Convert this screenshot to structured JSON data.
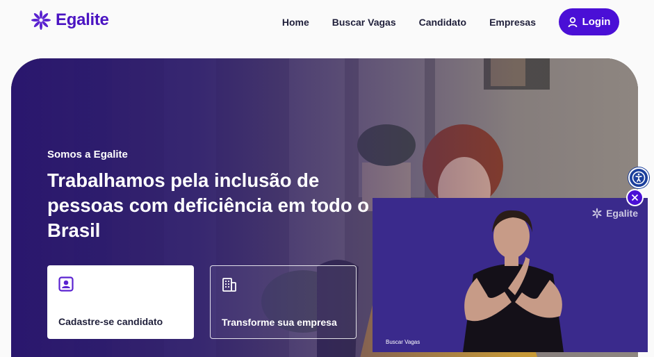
{
  "brand": {
    "name": "Egalite",
    "accent": "#4a0fd6"
  },
  "nav": {
    "items": [
      {
        "label": "Home"
      },
      {
        "label": "Buscar Vagas"
      },
      {
        "label": "Candidato"
      },
      {
        "label": "Empresas"
      }
    ],
    "login_label": "Login"
  },
  "hero": {
    "eyebrow": "Somos a Egalite",
    "headline": "Trabalhamos pela inclusão de pessoas com deficiência em todo o Brasil",
    "cards": [
      {
        "label": "Cadastre-se candidato",
        "icon": "person-badge-icon"
      },
      {
        "label": "Transforme sua empresa",
        "icon": "building-icon"
      }
    ]
  },
  "video_panel": {
    "logo_text": "Egalite",
    "caption": "Buscar Vagas"
  },
  "icons": {
    "accessibility": "accessibility-icon",
    "close": "close-icon",
    "user": "user-icon"
  }
}
